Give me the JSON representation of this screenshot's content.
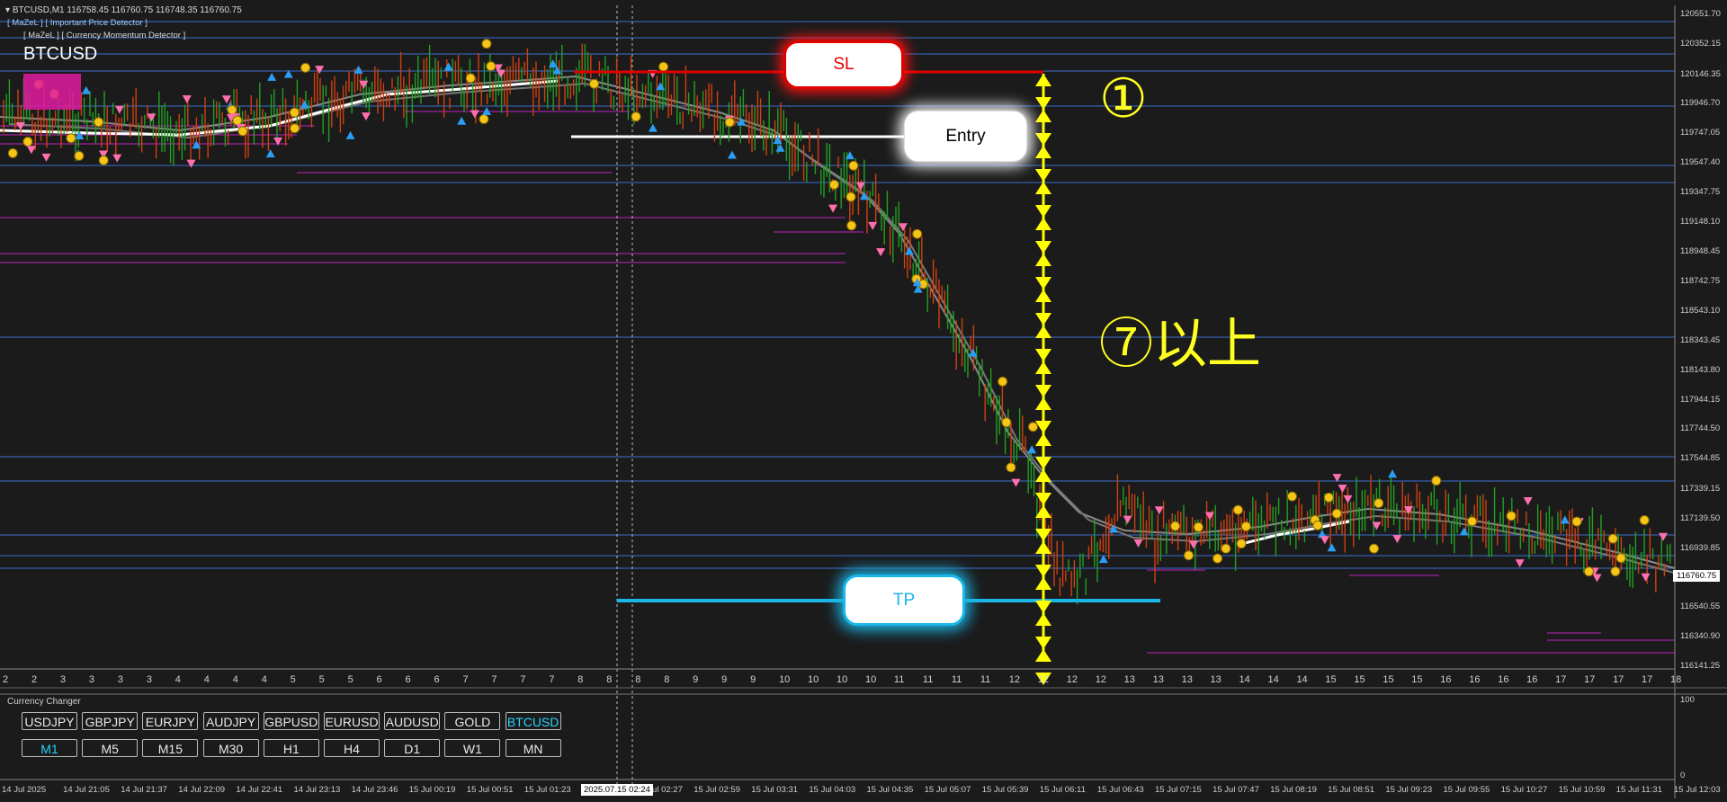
{
  "header": {
    "title_line": "BTCUSD,M1  116758.45 116760.75 116748.35 116760.75"
  },
  "indicators": {
    "line1": "[ MaZeL ] [ Important Price Detector ]",
    "line2": "[ MaZeL ] [ Currency Momentum Detector ]"
  },
  "symbol": "BTCUSD",
  "annotations": {
    "sl": "SL",
    "entry": "Entry",
    "tp": "TP",
    "circle_one": "①",
    "seven_plus": "⑦以上",
    "colors": {
      "sl": "#e00000",
      "entry": "#ffffff",
      "tp": "#1ab6e8",
      "arrow": "#ffff00"
    }
  },
  "price_axis": {
    "labels": [
      "120551.70",
      "120352.15",
      "120146.35",
      "119946.70",
      "119747.05",
      "119547.40",
      "119347.75",
      "119148.10",
      "118948.45",
      "118742.75",
      "118543.10",
      "118343.45",
      "118143.80",
      "117944.15",
      "117744.50",
      "117544.85",
      "117339.15",
      "117139.50",
      "116939.85",
      "116760.75",
      "116540.55",
      "116340.90",
      "116141.25"
    ],
    "current": "116760.75"
  },
  "sub_axis": {
    "top": "100",
    "bottom": "0"
  },
  "hour_labels": [
    "2",
    "2",
    "3",
    "3",
    "3",
    "3",
    "4",
    "4",
    "4",
    "4",
    "5",
    "5",
    "5",
    "6",
    "6",
    "6",
    "7",
    "7",
    "7",
    "7",
    "8",
    "8",
    "8",
    "8",
    "9",
    "9",
    "9",
    "10",
    "10",
    "10",
    "10",
    "11",
    "11",
    "11",
    "11",
    "12",
    "12",
    "12",
    "12",
    "13",
    "13",
    "13",
    "13",
    "14",
    "14",
    "14",
    "15",
    "15",
    "15",
    "15",
    "16",
    "16",
    "16",
    "16",
    "17",
    "17",
    "17",
    "17",
    "18"
  ],
  "time_labels": [
    "14 Jul 2025",
    "14 Jul 21:05",
    "14 Jul 21:37",
    "14 Jul 22:09",
    "14 Jul 22:41",
    "14 Jul 23:13",
    "14 Jul 23:46",
    "15 Jul 00:19",
    "15 Jul 00:51",
    "15 Jul 01:23",
    "15 Jul 02:27",
    "15 Jul 02:59",
    "15 Jul 03:31",
    "15 Jul 04:03",
    "15 Jul 04:35",
    "15 Jul 05:07",
    "15 Jul 05:39",
    "15 Jul 06:11",
    "15 Jul 06:43",
    "15 Jul 07:15",
    "15 Jul 07:47",
    "15 Jul 08:19",
    "15 Jul 08:51",
    "15 Jul 09:23",
    "15 Jul 09:55",
    "15 Jul 10:27",
    "15 Jul 10:59",
    "15 Jul 11:31",
    "15 Jul 12:03"
  ],
  "time_selected": "2025.07.15 02:24",
  "currency_changer": {
    "title": "Currency Changer",
    "symbols": [
      "USDJPY",
      "GBPJPY",
      "EURJPY",
      "AUDJPY",
      "GBPUSD",
      "EURUSD",
      "AUDUSD",
      "GOLD",
      "BTCUSD"
    ],
    "active_symbol": "BTCUSD",
    "timeframes": [
      "M1",
      "M5",
      "M15",
      "M30",
      "H1",
      "H4",
      "D1",
      "W1",
      "MN"
    ],
    "active_timeframe": "M1"
  }
}
